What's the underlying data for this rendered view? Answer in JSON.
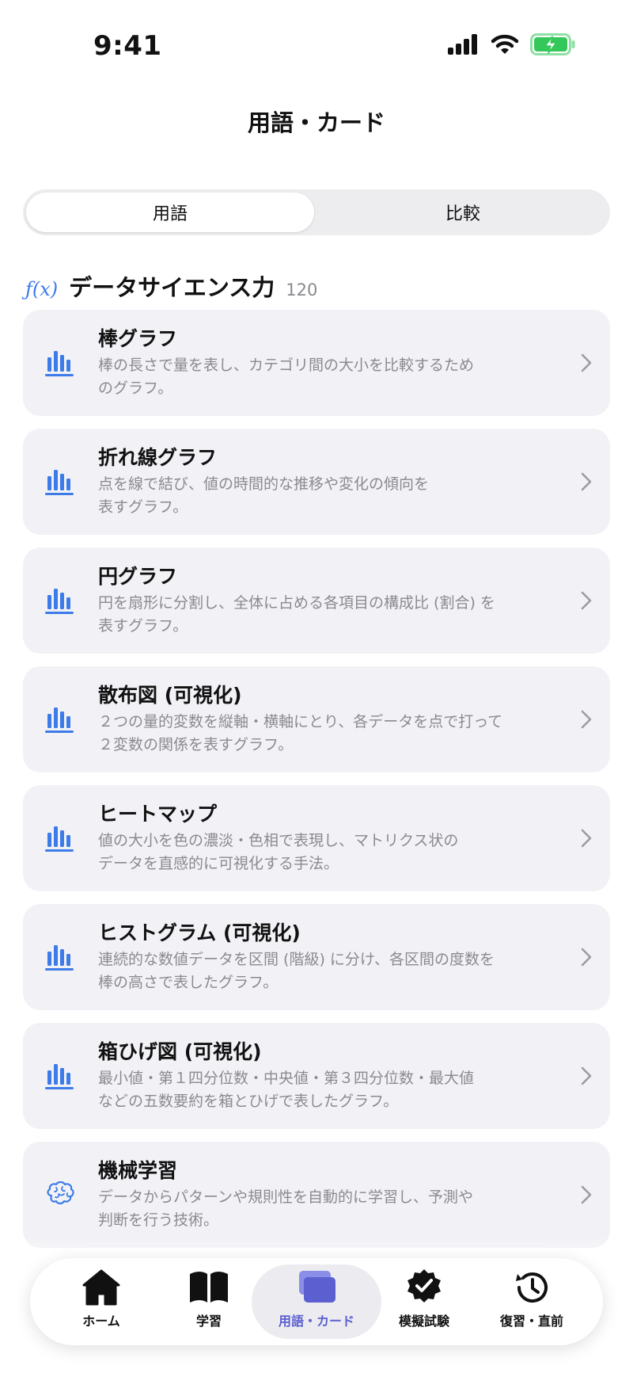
{
  "status": {
    "time": "9:41",
    "icons": [
      "cellular-signal-icon",
      "wifi-icon",
      "battery-charging-icon"
    ],
    "battery_color": "#34c759"
  },
  "header": {
    "title": "用語・カード"
  },
  "segmented": {
    "options": [
      "用語",
      "比較"
    ],
    "selected": "用語"
  },
  "section": {
    "icon": "function-icon",
    "icon_text": "ƒ(x)",
    "title": "データサイエンス力",
    "count": "120"
  },
  "terms": [
    {
      "name": "棒グラフ",
      "desc_line1": "棒の長さで量を表し、カテゴリ間の大小を比較するため",
      "desc_line2": "のグラフ。",
      "icon": "bar-chart-icon"
    },
    {
      "name": "折れ線グラフ",
      "desc_line1": "点を線で結び、値の時間的な推移や変化の傾向を",
      "desc_line2": "表すグラフ。",
      "icon": "bar-chart-icon"
    },
    {
      "name": "円グラフ",
      "desc_line1": "円を扇形に分割し、全体に占める各項目の構成比 (割合) を",
      "desc_line2": "表すグラフ。",
      "icon": "bar-chart-icon"
    },
    {
      "name": "散布図 (可視化)",
      "desc_line1": "２つの量的変数を縦軸・横軸にとり、各データを点で打って",
      "desc_line2": "２変数の関係を表すグラフ。",
      "icon": "bar-chart-icon"
    },
    {
      "name": "ヒートマップ",
      "desc_line1": "値の大小を色の濃淡・色相で表現し、マトリクス状の",
      "desc_line2": "データを直感的に可視化する手法。",
      "icon": "bar-chart-icon"
    },
    {
      "name": "ヒストグラム (可視化)",
      "desc_line1": "連続的な数値データを区間 (階級) に分け、各区間の度数を",
      "desc_line2": "棒の高さで表したグラフ。",
      "icon": "bar-chart-icon"
    },
    {
      "name": "箱ひげ図 (可視化)",
      "desc_line1": "最小値・第１四分位数・中央値・第３四分位数・最大値",
      "desc_line2": "などの五数要約を箱とひげで表したグラフ。",
      "icon": "bar-chart-icon"
    },
    {
      "name": "機械学習",
      "desc_line1": "データからパターンや規則性を自動的に学習し、予測や",
      "desc_line2": "判断を行う技術。",
      "icon": "brain-icon"
    }
  ],
  "tabbar": {
    "tabs": [
      {
        "label": "ホーム",
        "icon": "home-icon"
      },
      {
        "label": "学習",
        "icon": "book-icon"
      },
      {
        "label": "用語・カード",
        "icon": "cards-icon",
        "active": true
      },
      {
        "label": "模擬試験",
        "icon": "seal-check-icon"
      },
      {
        "label": "復習・直前",
        "icon": "history-icon"
      }
    ],
    "active_color": "#5b5fd0"
  },
  "colors": {
    "accent": "#3c7be8",
    "card_bg": "#f2f2f6",
    "secondary_text": "#8a8a8f"
  }
}
